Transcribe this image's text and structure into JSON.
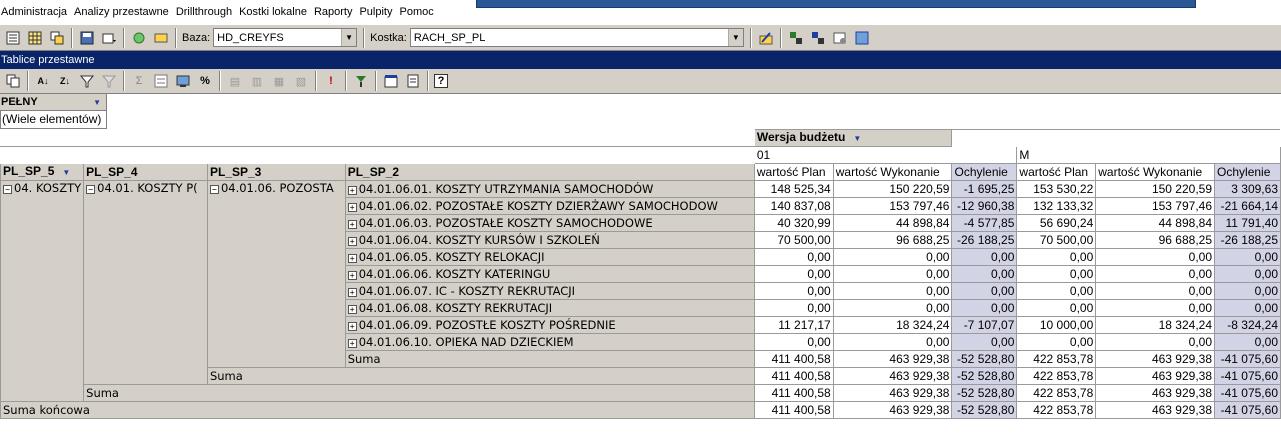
{
  "menu": [
    "Administracja",
    "Analizy przestawne",
    "Drillthrough",
    "Kostki lokalne",
    "Raporty",
    "Pulpity",
    "Pomoc"
  ],
  "toolbar": {
    "baza_label": "Baza:",
    "baza_value": "HD_CREYFS",
    "kostka_label": "Kostka:",
    "kostka_value": "RACH_SP_PL"
  },
  "panel": {
    "title": "Tablice przestawne"
  },
  "filter": {
    "field": "PEŁNY",
    "value": "(Wiele elementów)"
  },
  "pivot": {
    "col_field": "Wersja budżetu",
    "versions": [
      "01",
      "M"
    ],
    "measures": [
      "wartość Plan",
      "wartość Wykonanie",
      "Ochylenie",
      "wartość Plan",
      "wartość Wykonanie",
      "Ochylenie"
    ],
    "row_fields": [
      "PL_SP_5",
      "PL_SP_4",
      "PL_SP_3",
      "PL_SP_2"
    ],
    "sp5": "04. KOSZTY",
    "sp4": "04.01. KOSZTY P(",
    "sp3": "04.01.06. POZOSTA",
    "rows": [
      {
        "label": "04.01.06.01. KOSZTY UTRZYMANIA SAMOCHODÓW",
        "v": [
          "148 525,34",
          "150 220,59",
          "-1 695,25",
          "153 530,22",
          "150 220,59",
          "3 309,63"
        ]
      },
      {
        "label": "04.01.06.02. POZOSTAŁE KOSZTY DZIERŻAWY SAMOCHODOW",
        "v": [
          "140 837,08",
          "153 797,46",
          "-12 960,38",
          "132 133,32",
          "153 797,46",
          "-21 664,14"
        ]
      },
      {
        "label": "04.01.06.03. POZOSTAŁE KOSZTY SAMOCHODOWE",
        "v": [
          "40 320,99",
          "44 898,84",
          "-4 577,85",
          "56 690,24",
          "44 898,84",
          "11 791,40"
        ]
      },
      {
        "label": "04.01.06.04. KOSZTY KURSÓW I SZKOLEŃ",
        "v": [
          "70 500,00",
          "96 688,25",
          "-26 188,25",
          "70 500,00",
          "96 688,25",
          "-26 188,25"
        ]
      },
      {
        "label": "04.01.06.05. KOSZTY RELOKACJI",
        "v": [
          "0,00",
          "0,00",
          "0,00",
          "0,00",
          "0,00",
          "0,00"
        ]
      },
      {
        "label": "04.01.06.06. KOSZTY KATERINGU",
        "v": [
          "0,00",
          "0,00",
          "0,00",
          "0,00",
          "0,00",
          "0,00"
        ]
      },
      {
        "label": "04.01.06.07. IC - KOSZTY REKRUTACJI",
        "v": [
          "0,00",
          "0,00",
          "0,00",
          "0,00",
          "0,00",
          "0,00"
        ]
      },
      {
        "label": "04.01.06.08. KOSZTY REKRUTACJI",
        "v": [
          "0,00",
          "0,00",
          "0,00",
          "0,00",
          "0,00",
          "0,00"
        ]
      },
      {
        "label": "04.01.06.09. POZOSTŁE KOSZTY POŚREDNIE",
        "v": [
          "11 217,17",
          "18 324,24",
          "-7 107,07",
          "10 000,00",
          "18 324,24",
          "-8 324,24"
        ]
      },
      {
        "label": "04.01.06.10. OPIEKA NAD DZIECKIEM",
        "v": [
          "0,00",
          "0,00",
          "0,00",
          "0,00",
          "0,00",
          "0,00"
        ]
      }
    ],
    "suma_label": "Suma",
    "grand_label": "Suma końcowa",
    "suma_values": [
      "411 400,58",
      "463 929,38",
      "-52 528,80",
      "422 853,78",
      "463 929,38",
      "-41 075,60"
    ]
  }
}
